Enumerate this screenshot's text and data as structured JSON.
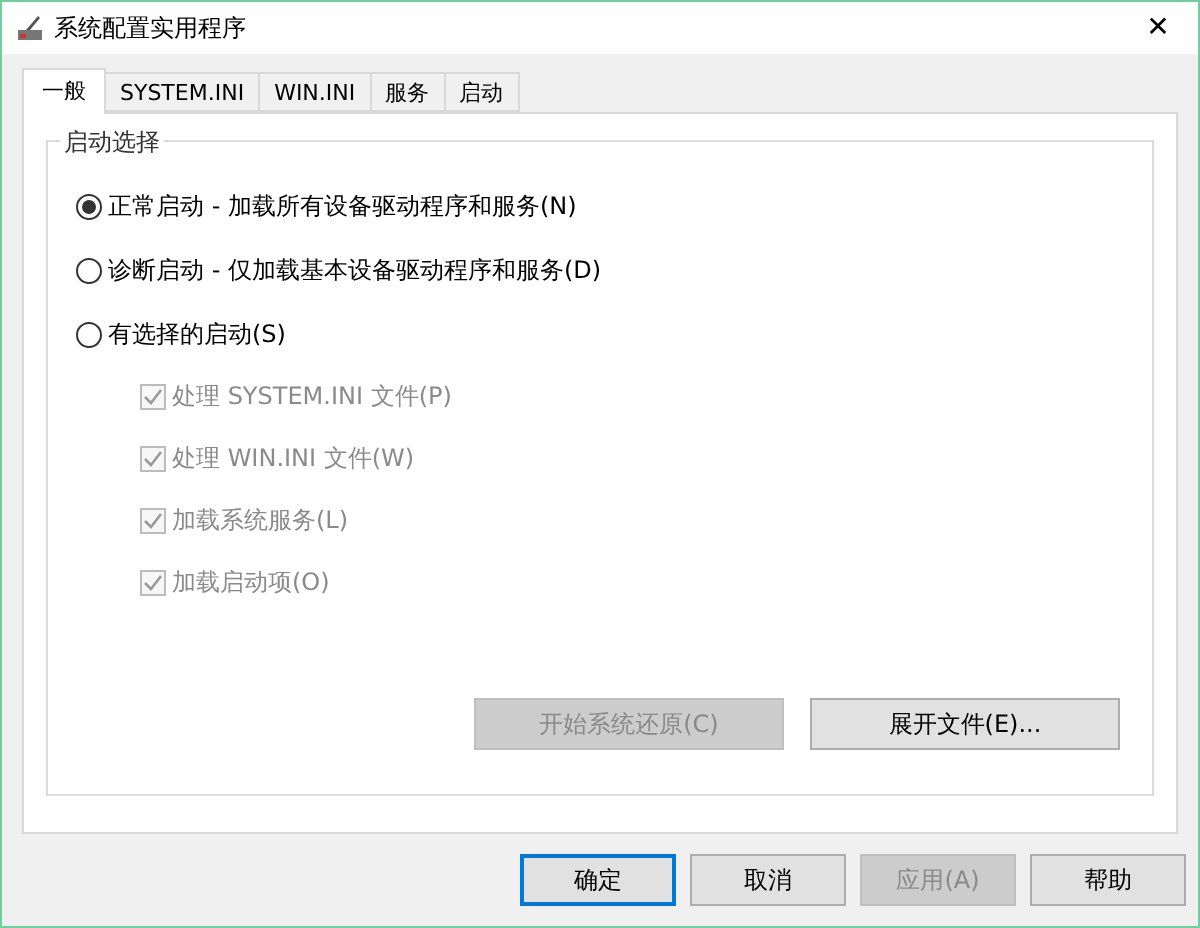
{
  "window": {
    "title": "系统配置实用程序",
    "close": "✕"
  },
  "tabs": [
    {
      "label": "一般",
      "selected": true
    },
    {
      "label": "SYSTEM.INI",
      "selected": false
    },
    {
      "label": "WIN.INI",
      "selected": false
    },
    {
      "label": "服务",
      "selected": false
    },
    {
      "label": "启动",
      "selected": false
    }
  ],
  "group": {
    "title": "启动选择",
    "options": [
      {
        "label": "正常启动 - 加载所有设备驱动程序和服务(N)",
        "selected": true
      },
      {
        "label": "诊断启动 - 仅加载基本设备驱动程序和服务(D)",
        "selected": false
      },
      {
        "label": "有选择的启动(S)",
        "selected": false
      }
    ],
    "sub_options": [
      {
        "label": "处理 SYSTEM.INI 文件(P)",
        "checked": true,
        "disabled": true
      },
      {
        "label": "处理 WIN.INI 文件(W)",
        "checked": true,
        "disabled": true
      },
      {
        "label": "加载系统服务(L)",
        "checked": true,
        "disabled": true
      },
      {
        "label": "加载启动项(O)",
        "checked": true,
        "disabled": true
      }
    ],
    "buttons": [
      {
        "label": "开始系统还原(C)",
        "disabled": true
      },
      {
        "label": "展开文件(E)...",
        "disabled": false
      }
    ]
  },
  "dialog_buttons": [
    {
      "label": "确定",
      "disabled": false,
      "default": true
    },
    {
      "label": "取消",
      "disabled": false,
      "default": false
    },
    {
      "label": "应用(A)",
      "disabled": true,
      "default": false
    },
    {
      "label": "帮助",
      "disabled": false,
      "default": false
    }
  ]
}
